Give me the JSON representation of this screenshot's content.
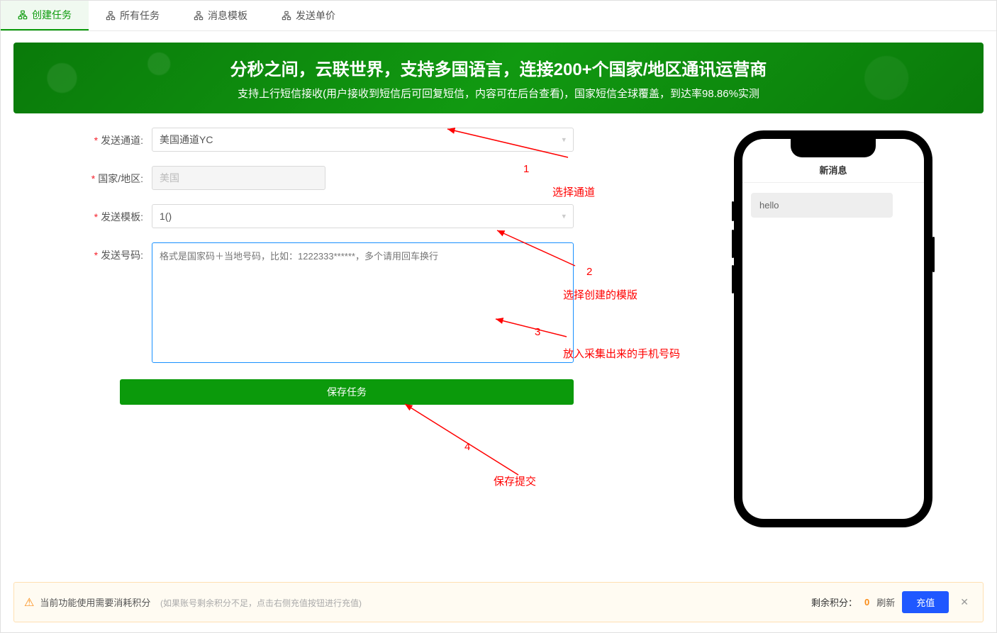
{
  "tabs": {
    "create": "创建任务",
    "all": "所有任务",
    "template": "消息模板",
    "price": "发送单价"
  },
  "banner": {
    "title": "分秒之间，云联世界，支持多国语言，连接200+个国家/地区通讯运营商",
    "subtitle": "支持上行短信接收(用户接收到短信后可回复短信，内容可在后台查看)，国家短信全球覆盖，到达率98.86%实测"
  },
  "form": {
    "channel_label": "发送通道:",
    "channel_value": "美国通道YC",
    "country_label": "国家/地区:",
    "country_value": "美国",
    "template_label": "发送模板:",
    "template_value": "1()",
    "number_label": "发送号码:",
    "number_placeholder": "格式是国家码＋当地号码，比如：1222333******，多个请用回车换行",
    "save_btn": "保存任务"
  },
  "phone": {
    "header": "新消息",
    "msg": "hello"
  },
  "annotations": {
    "n1": "1",
    "t1": "选择通道",
    "n2": "2",
    "t2": "选择创建的模版",
    "n3": "3",
    "t3": "放入采集出来的手机号码",
    "n4": "4",
    "t4": "保存提交"
  },
  "footer": {
    "main": "当前功能使用需要消耗积分",
    "note": "(如果账号剩余积分不足，点击右侧充值按钮进行充值)",
    "balance_label": "剩余积分：",
    "balance_value": "0",
    "refresh": "刷新",
    "recharge": "充值"
  }
}
